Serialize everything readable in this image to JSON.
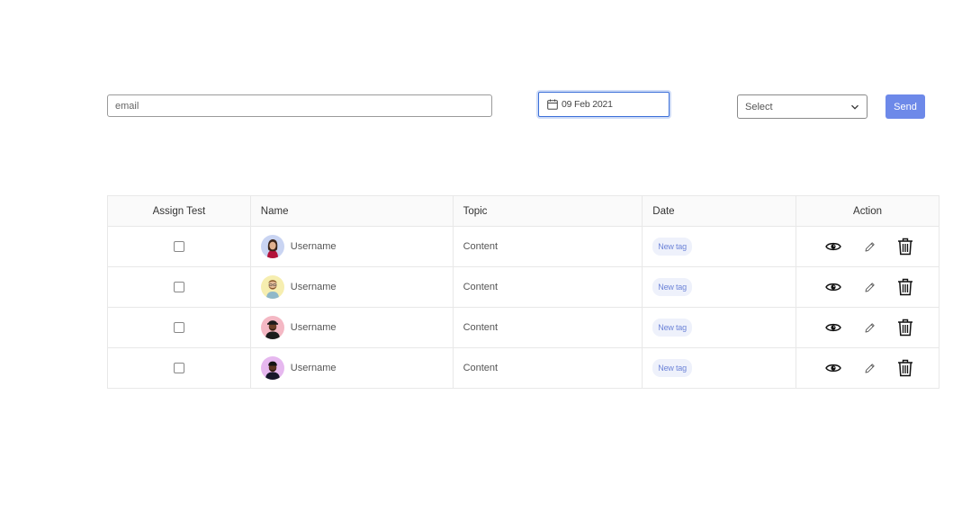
{
  "form": {
    "email_placeholder": "email",
    "email_value": "",
    "date_value": "09 Feb 2021",
    "select_value": "Select",
    "send_label": "Send"
  },
  "colors": {
    "accent": "#6d89e9",
    "tag_bg": "#eef1fb",
    "tag_text": "#6d84d8"
  },
  "table": {
    "headers": {
      "assign": "Assign Test",
      "name": "Name",
      "topic": "Topic",
      "date": "Date",
      "action": "Action"
    },
    "rows": [
      {
        "checked": false,
        "avatar": "avatar-woman-dark-hair",
        "name": "Username",
        "topic": "Content",
        "tag": "New tag"
      },
      {
        "checked": false,
        "avatar": "avatar-man-beard",
        "name": "Username",
        "topic": "Content",
        "tag": "New tag"
      },
      {
        "checked": false,
        "avatar": "avatar-man-cap",
        "name": "Username",
        "topic": "Content",
        "tag": "New tag"
      },
      {
        "checked": false,
        "avatar": "avatar-man-beanie",
        "name": "Username",
        "topic": "Content",
        "tag": "New tag"
      }
    ],
    "action_icons": [
      "eye-icon",
      "pencil-icon",
      "trash-icon"
    ]
  }
}
